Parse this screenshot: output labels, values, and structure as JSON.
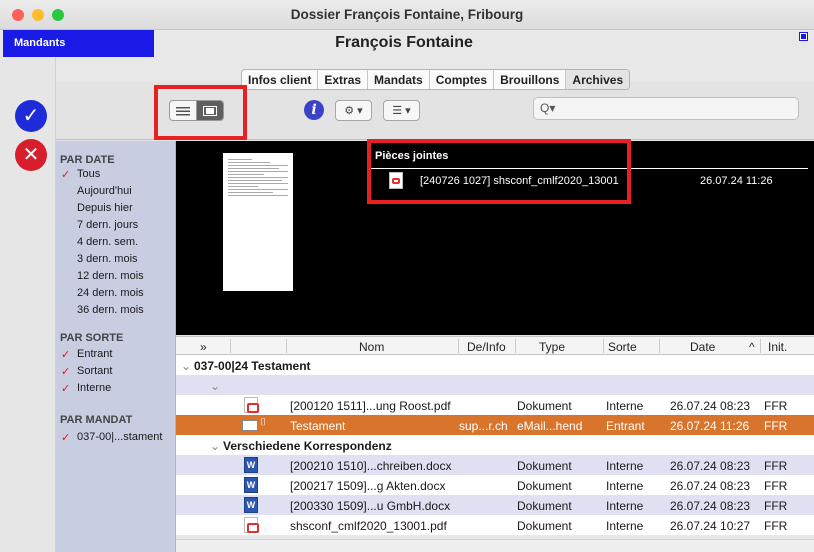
{
  "window": {
    "title": "Dossier François Fontaine, Fribourg"
  },
  "header": {
    "mandants_label": "Mandants",
    "client_name": "François Fontaine"
  },
  "tabs": [
    "Infos client",
    "Extras",
    "Mandats",
    "Comptes",
    "Brouillons",
    "Archives"
  ],
  "selected_tab": "Archives",
  "toolbar": {
    "info_label": "i",
    "search_placeholder": "Q▾"
  },
  "filters": {
    "by_date_title": "PAR DATE",
    "by_date": [
      "Tous",
      "Aujourd'hui",
      "Depuis hier",
      "7 dern. jours",
      "4 dern. sem.",
      "3 dern. mois",
      "12 dern. mois",
      "24 dern. mois",
      "36 dern. mois"
    ],
    "by_date_checked": "Tous",
    "by_type_title": "PAR SORTE",
    "by_type": [
      "Entrant",
      "Sortant",
      "Interne"
    ],
    "by_mandate_title": "PAR MANDAT",
    "by_mandate": [
      "037-00|...stament"
    ],
    "check_mark": "✓"
  },
  "attachments": {
    "title": "Pièces jointes",
    "items": [
      {
        "name": "[240726 1027] shsconf_cmlf2020_13001",
        "date": "26.07.24 11:26"
      }
    ]
  },
  "table": {
    "columns": [
      "»",
      "Nom",
      "De/Info",
      "Sorte",
      "Sorte",
      "Date",
      "Init."
    ],
    "headers": {
      "expand": "»",
      "name": "Nom",
      "from": "De/Info",
      "type": "Type",
      "kind": "Sorte",
      "date": "Date",
      "sort_arrow": "^",
      "init": "Init."
    },
    "group1": "037-00|24 Testament",
    "group2": "Verschiedene Korrespondenz",
    "rows": [
      {
        "icon": "pdf",
        "name": "[200120 1511]...ung Roost.pdf",
        "from": "",
        "type": "Dokument",
        "kind": "Interne",
        "date": "26.07.24 08:23",
        "init": "FFR"
      },
      {
        "icon": "mail",
        "name": "Testament",
        "from": "sup...r.ch",
        "type": "eMail...hend",
        "kind": "Entrant",
        "date": "26.07.24 11:26",
        "init": "FFR"
      },
      {
        "icon": "word",
        "name": "[200210 1510]...chreiben.docx",
        "from": "",
        "type": "Dokument",
        "kind": "Interne",
        "date": "26.07.24 08:23",
        "init": "FFR"
      },
      {
        "icon": "word",
        "name": "[200217 1509]...g Akten.docx",
        "from": "",
        "type": "Dokument",
        "kind": "Interne",
        "date": "26.07.24 08:23",
        "init": "FFR"
      },
      {
        "icon": "word",
        "name": "[200330 1509]...u GmbH.docx",
        "from": "",
        "type": "Dokument",
        "kind": "Interne",
        "date": "26.07.24 08:23",
        "init": "FFR"
      },
      {
        "icon": "pdf",
        "name": "shsconf_cmlf2020_13001.pdf",
        "from": "",
        "type": "Dokument",
        "kind": "Interne",
        "date": "26.07.24 10:27",
        "init": "FFR"
      }
    ]
  },
  "colors": {
    "accent": "#1a1ae6",
    "highlight": "#e52121",
    "selected_row": "#d8742c",
    "row_alt": "#dfe1f2"
  }
}
